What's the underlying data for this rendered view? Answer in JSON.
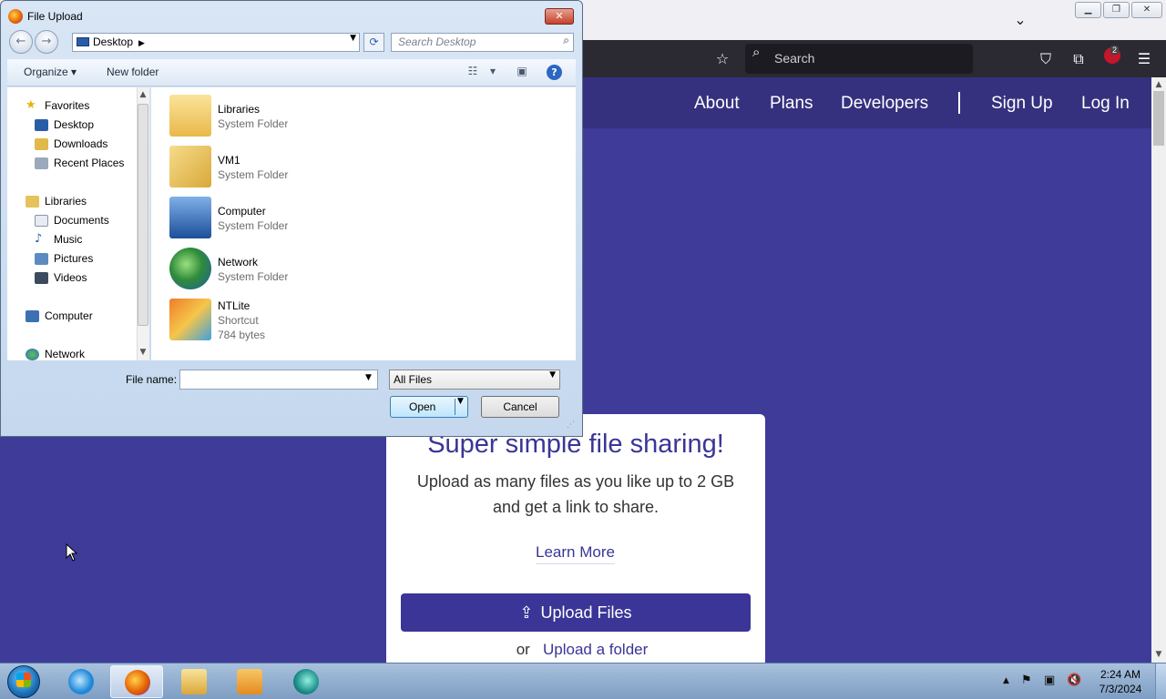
{
  "browser": {
    "tab_list_icon": "chevron-down-icon",
    "toolbar": {
      "search_placeholder": "Search",
      "extension_badge_count": "2"
    }
  },
  "site": {
    "nav": [
      "About",
      "Plans",
      "Developers",
      "Sign Up",
      "Log In"
    ],
    "hero": {
      "title": "Super simple file sharing!",
      "line1": "Upload as many files as you like up to 2 GB",
      "line2": "and get a link to share.",
      "learn_more": "Learn More",
      "upload_button": "Upload Files",
      "or": "or",
      "upload_folder": "Upload a folder"
    },
    "colors": {
      "background": "#3f3b99",
      "accent": "#3a3596"
    }
  },
  "dialog": {
    "title": "File Upload",
    "address": "Desktop",
    "search_placeholder": "Search Desktop",
    "organize": "Organize",
    "new_folder": "New folder",
    "nav": {
      "favorites": "Favorites",
      "favorites_items": [
        "Desktop",
        "Downloads",
        "Recent Places"
      ],
      "libraries": "Libraries",
      "libraries_items": [
        "Documents",
        "Music",
        "Pictures",
        "Videos"
      ],
      "computer": "Computer",
      "network": "Network"
    },
    "files": [
      {
        "name": "Libraries",
        "type": "System Folder",
        "icon": "libraries-folder-icon"
      },
      {
        "name": "VM1",
        "type": "System Folder",
        "icon": "user-folder-icon"
      },
      {
        "name": "Computer",
        "type": "System Folder",
        "icon": "computer-icon"
      },
      {
        "name": "Network",
        "type": "System Folder",
        "icon": "network-icon"
      },
      {
        "name": "NTLite",
        "type": "Shortcut",
        "size": "784 bytes",
        "icon": "ntlite-shortcut-icon"
      }
    ],
    "file_name_label": "File name:",
    "file_name_value": "",
    "filter": "All Files",
    "open": "Open",
    "cancel": "Cancel"
  },
  "taskbar": {
    "apps": [
      "internet-explorer-icon",
      "firefox-icon",
      "file-explorer-icon",
      "media-player-icon",
      "app-icon"
    ],
    "clock_time": "2:24 AM",
    "clock_date": "7/3/2024"
  }
}
